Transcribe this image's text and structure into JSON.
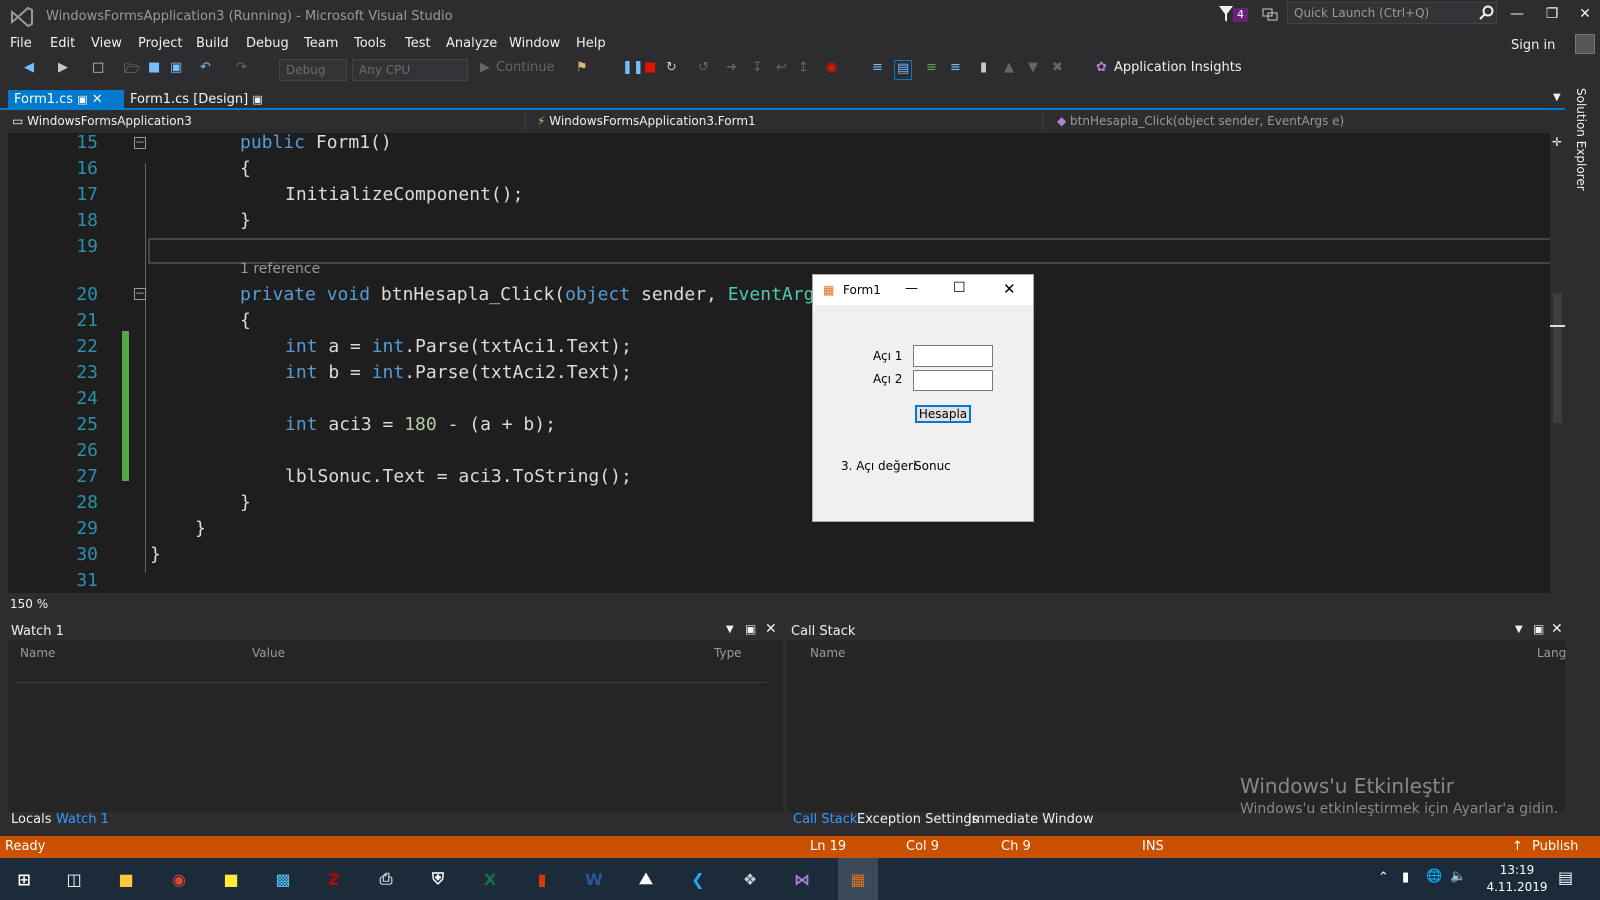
{
  "window": {
    "title": "WindowsFormsApplication3 (Running) - Microsoft Visual Studio",
    "notif_count": "4",
    "quick_launch_placeholder": "Quick Launch (Ctrl+Q)",
    "sign_in": "Sign in",
    "solution_explorer": "Solution Explorer"
  },
  "menu": [
    "File",
    "Edit",
    "View",
    "Project",
    "Build",
    "Debug",
    "Team",
    "Tools",
    "Test",
    "Analyze",
    "Window",
    "Help"
  ],
  "toolbar": {
    "config": "Debug",
    "platform": "Any CPU",
    "continue": "Continue",
    "app_insights": "Application Insights"
  },
  "tabs": {
    "active": "Form1.cs",
    "second": "Form1.cs [Design]"
  },
  "nav": {
    "project": "WindowsFormsApplication3",
    "class": "WindowsFormsApplication3.Form1",
    "member": "btnHesapla_Click(object sender, EventArgs e)"
  },
  "editor": {
    "reference_hint": "1 reference",
    "lines": [
      "15",
      "16",
      "17",
      "18",
      "19",
      "20",
      "21",
      "22",
      "23",
      "24",
      "25",
      "26",
      "27",
      "28",
      "29",
      "30",
      "31"
    ],
    "code": {
      "l15": "public Form1()",
      "l16": "{",
      "l17": "InitializeComponent();",
      "l18": "}",
      "l21": "{",
      "l28": "}",
      "l29": "}",
      "l30": "}"
    },
    "zoom": "150 %"
  },
  "form1": {
    "title": "Form1",
    "label_a1": "Açı 1",
    "label_a2": "Açı 2",
    "button": "Hesapla",
    "result_label": "3. Açı değeri",
    "result_value": "Sonuc"
  },
  "watch": {
    "title": "Watch 1",
    "col_name": "Name",
    "col_value": "Value",
    "col_type": "Type",
    "tab_locals": "Locals",
    "tab_watch": "Watch 1"
  },
  "callstack": {
    "title": "Call Stack",
    "col_name": "Name",
    "col_lang": "Lang",
    "tab_callstack": "Call Stack",
    "tab_exceptions": "Exception Settings",
    "tab_immediate": "Immediate Window"
  },
  "status": {
    "ready": "Ready",
    "ln": "Ln 19",
    "col": "Col 9",
    "ch": "Ch 9",
    "ins": "INS",
    "publish": "Publish"
  },
  "watermark": {
    "line1": "Windows'u Etkinleştir",
    "line2": "Windows'u etkinleştirmek için Ayarlar'a gidin."
  },
  "clock": {
    "time": "13:19",
    "date": "4.11.2019"
  },
  "colors": {
    "accent": "#007acc",
    "status": "#ca5100",
    "editor_bg": "#1e1e1e",
    "keyword": "#569cd6",
    "type": "#4ec9b0",
    "number": "#b5cea8"
  }
}
